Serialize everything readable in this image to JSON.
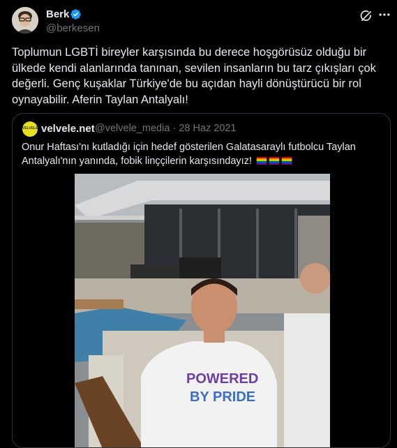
{
  "author": {
    "name": "Berk",
    "handle": "@berkesen"
  },
  "icons": {
    "verified": "verified-badge-icon",
    "grok": "grok-icon",
    "more": "more-icon"
  },
  "tweet": {
    "text": "Toplumun LGBTİ bireyler karşısında bu derece hoşgörüsüz olduğu bir ülkede kendi alanlarında tanınan, sevilen insanların bu tarz çıkışları çok değerli. Genç kuşaklar Türkiye'de bu açıdan hayli dönüştürücü bir rol oynayabilir. Aferin Taylan Antalyalı!"
  },
  "quote": {
    "avatar_text": "VELVELE",
    "name": "velvele.net",
    "handle": "@velvele_media",
    "separator": "·",
    "date": "28 Haz 2021",
    "text": "Onur Haftası'nı kutladığı için hedef gösterilen Galatasaraylı futbolcu Taylan Antalyalı'nın yanında, fobik linççilerin karşısındayız!",
    "flags": [
      "rainbow-flag",
      "rainbow-flag",
      "rainbow-flag"
    ],
    "shirt_text_1": "POWERED",
    "shirt_text_2": "BY PRIDE"
  },
  "colors": {
    "accent": "#1d9bf0",
    "background": "#000000",
    "border": "#2f3336",
    "muted": "#71767b"
  }
}
